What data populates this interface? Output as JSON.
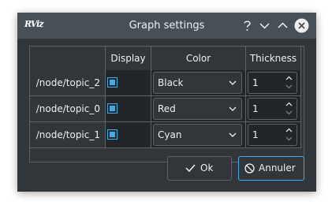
{
  "window": {
    "title": "Graph settings",
    "app_icon_text": "RViz",
    "buttons": [
      "help",
      "minimize",
      "maximize",
      "close"
    ]
  },
  "table": {
    "headers": [
      "Display",
      "Color",
      "Thickness"
    ],
    "rows": [
      {
        "topic": "/node/topic_2",
        "display": true,
        "color": "Black",
        "thickness": "1"
      },
      {
        "topic": "/node/topic_0",
        "display": true,
        "color": "Red",
        "thickness": "1"
      },
      {
        "topic": "/node/topic_1",
        "display": true,
        "color": "Cyan",
        "thickness": "1"
      }
    ]
  },
  "footer": {
    "ok_label": "Ok",
    "cancel_label": "Annuler"
  },
  "icons": {
    "help": "help-icon",
    "minimize": "chevron-down-icon",
    "maximize": "chevron-up-icon",
    "close": "close-icon",
    "ok": "checkmark-icon",
    "cancel": "cancel-icon"
  },
  "colors": {
    "accent": "#3daee9",
    "window_bg": "#31363b",
    "titlebar_bg": "#475057",
    "text": "#eff0f1"
  }
}
